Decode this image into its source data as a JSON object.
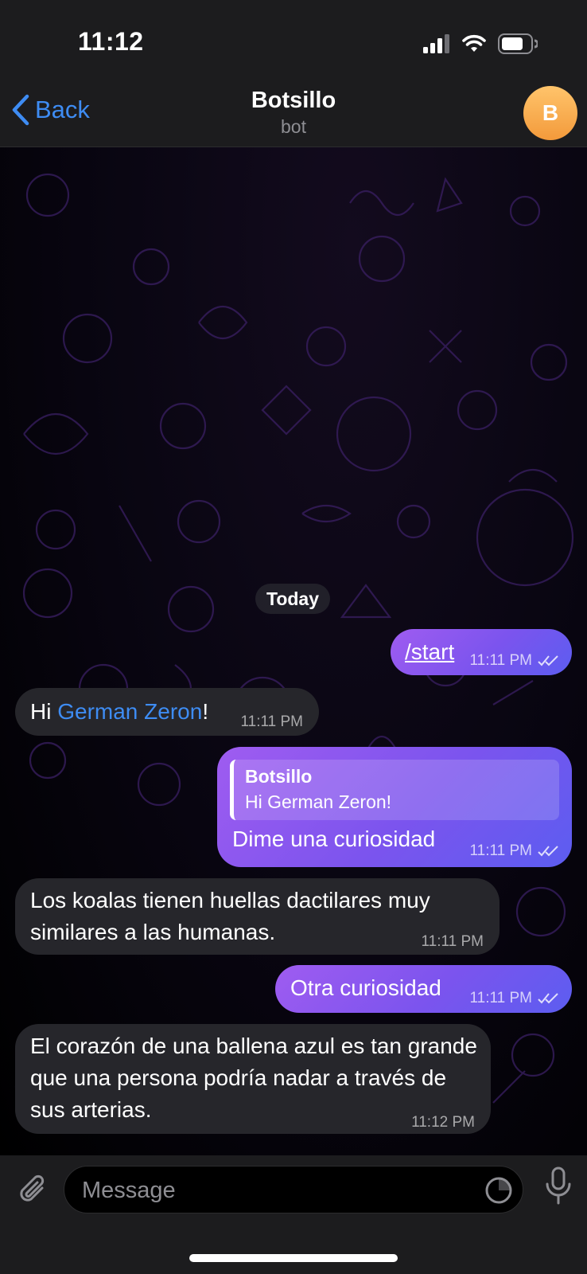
{
  "status_bar": {
    "time": "11:12"
  },
  "nav": {
    "back_label": "Back",
    "title": "Botsillo",
    "subtitle": "bot",
    "avatar_letter": "B",
    "accent": "#3e8cf3",
    "avatar_color": "#f5a342"
  },
  "chat": {
    "date_label": "Today",
    "messages": [
      {
        "from": "me",
        "text": "/start",
        "time": "11:11 PM",
        "read": true
      },
      {
        "from": "bot",
        "text_prefix": "Hi ",
        "link": "German Zeron",
        "text_suffix": "!",
        "time": "11:11 PM"
      },
      {
        "from": "me",
        "reply_to_name": "Botsillo",
        "reply_to_text": "Hi German Zeron!",
        "text": "Dime una curiosidad",
        "time": "11:11 PM",
        "read": true
      },
      {
        "from": "bot",
        "text": "Los koalas tienen huellas dactilares muy similares a las humanas.",
        "time": "11:11 PM"
      },
      {
        "from": "me",
        "text": "Otra curiosidad",
        "time": "11:11 PM",
        "read": true
      },
      {
        "from": "bot",
        "text": "El corazón de una ballena azul es tan grande que una persona podría nadar a través de sus arterias.",
        "time": "11:12 PM"
      }
    ]
  },
  "input": {
    "placeholder": "Message"
  },
  "icons": [
    "signal-icon",
    "wifi-icon",
    "battery-icon",
    "back-chevron-icon",
    "read-checkmarks-icon",
    "attach-icon",
    "sticker-icon",
    "microphone-icon"
  ]
}
